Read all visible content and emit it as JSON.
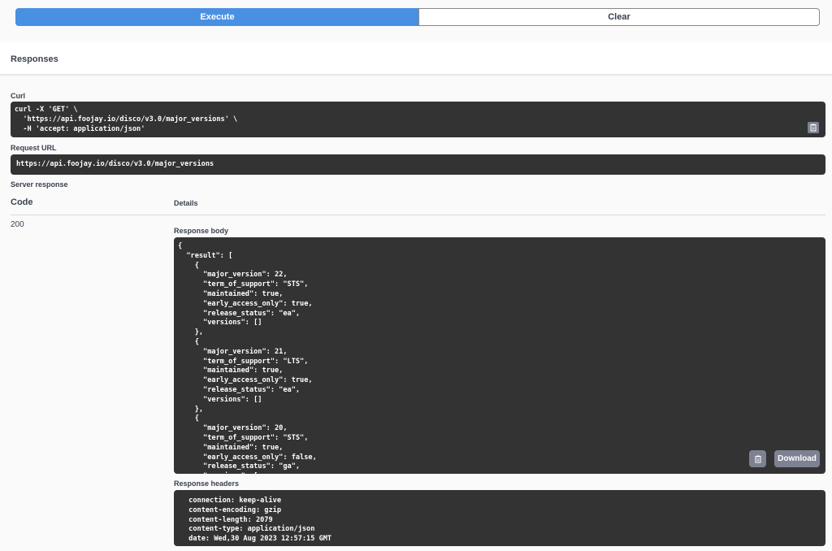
{
  "actions": {
    "execute_label": "Execute",
    "clear_label": "Clear"
  },
  "responses": {
    "title": "Responses"
  },
  "curl": {
    "label": "Curl",
    "text": "curl -X 'GET' \\\n  'https://api.foojay.io/disco/v3.0/major_versions' \\\n  -H 'accept: application/json'",
    "copy_icon": "clipboard-icon"
  },
  "request_url": {
    "label": "Request URL",
    "value": "https://api.foojay.io/disco/v3.0/major_versions"
  },
  "server_response": {
    "label": "Server response",
    "code_header": "Code",
    "details_header": "Details",
    "code": "200",
    "body_label": "Response body",
    "body": "{\n  \"result\": [\n    {\n      \"major_version\": 22,\n      \"term_of_support\": \"STS\",\n      \"maintained\": true,\n      \"early_access_only\": true,\n      \"release_status\": \"ea\",\n      \"versions\": []\n    },\n    {\n      \"major_version\": 21,\n      \"term_of_support\": \"LTS\",\n      \"maintained\": true,\n      \"early_access_only\": true,\n      \"release_status\": \"ea\",\n      \"versions\": []\n    },\n    {\n      \"major_version\": 20,\n      \"term_of_support\": \"STS\",\n      \"maintained\": true,\n      \"early_access_only\": false,\n      \"release_status\": \"ga\",\n      \"versions\": [",
    "download_label": "Download",
    "headers_label": "Response headers",
    "headers": " connection: keep-alive\n content-encoding: gzip\n content-length: 2079\n content-type: application/json\n date: Wed,30 Aug 2023 12:57:15 GMT"
  },
  "colors": {
    "execute": "#4990e2",
    "dark_panel": "#333333",
    "icon_button": "#7d8293"
  }
}
